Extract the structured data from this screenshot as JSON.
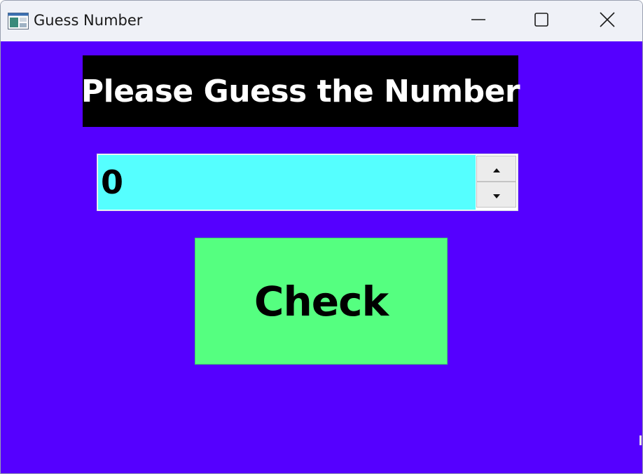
{
  "window": {
    "title": "Guess Number",
    "icon": "app-window-icon",
    "controls": {
      "minimize_icon": "minimize-icon",
      "maximize_icon": "maximize-icon",
      "close_icon": "close-icon"
    }
  },
  "main": {
    "heading": "Please Guess the Number",
    "guess_input": {
      "value": "0",
      "up_icon": "arrow-up-icon",
      "down_icon": "arrow-down-icon"
    },
    "check_label": "Check"
  },
  "colors": {
    "background": "#5500ff",
    "heading_bg": "#000000",
    "heading_text": "#ffffff",
    "input_bg": "#55ffff",
    "button_bg": "#55ff80",
    "titlebar_bg": "#eff1f7"
  }
}
